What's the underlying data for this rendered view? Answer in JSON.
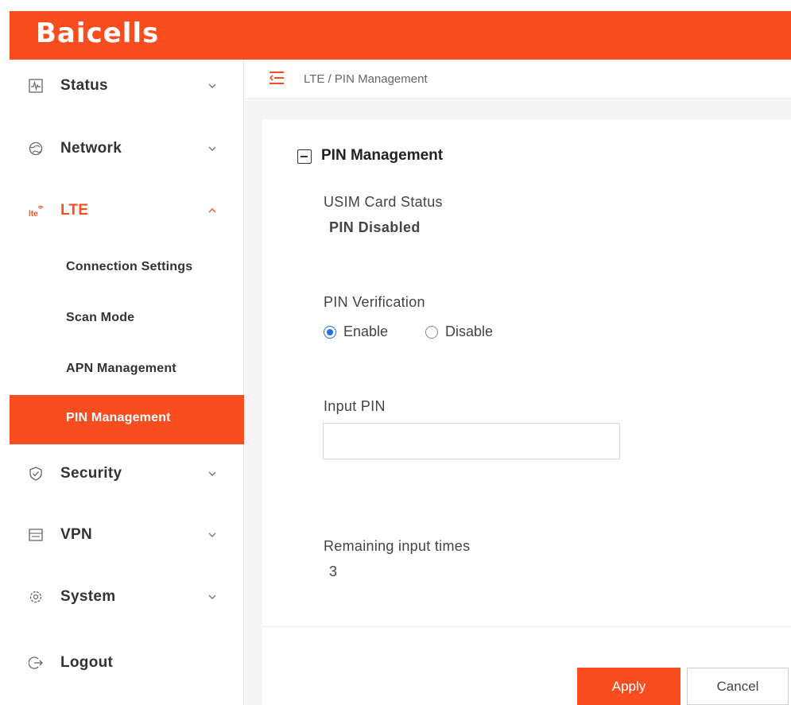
{
  "brand": {
    "logo_text": "Baicells",
    "color": "#f94d1f"
  },
  "breadcrumb": {
    "text": "LTE / PIN Management",
    "icon": "menu-fold-icon"
  },
  "sidebar": {
    "items": [
      {
        "label": "Status",
        "icon": "pulse-icon"
      },
      {
        "label": "Network",
        "icon": "globe-icon"
      },
      {
        "label": "LTE",
        "icon": "lte-icon",
        "expanded": true
      },
      {
        "label": "Security",
        "icon": "shield-icon"
      },
      {
        "label": "VPN",
        "icon": "vpn-icon"
      },
      {
        "label": "System",
        "icon": "gear-icon"
      },
      {
        "label": "Logout",
        "icon": "logout-icon"
      }
    ],
    "lte_sub": [
      {
        "label": "Connection Settings"
      },
      {
        "label": "Scan Mode"
      },
      {
        "label": "APN Management"
      },
      {
        "label": "PIN Management",
        "active": true
      }
    ]
  },
  "main": {
    "section_title": "PIN Management",
    "usim_status_label": "USIM Card Status",
    "usim_status_value": "PIN Disabled",
    "pin_verification_label": "PIN Verification",
    "pin_verification_options": [
      "Enable",
      "Disable"
    ],
    "pin_verification_selected": "Enable",
    "input_pin_label": "Input PIN",
    "input_pin_value": "",
    "remaining_label": "Remaining input times",
    "remaining_value": "3"
  },
  "footer": {
    "apply_label": "Apply",
    "cancel_label": "Cancel"
  },
  "colors": {
    "accent": "#f94d1f",
    "radio": "#1e73e8"
  }
}
